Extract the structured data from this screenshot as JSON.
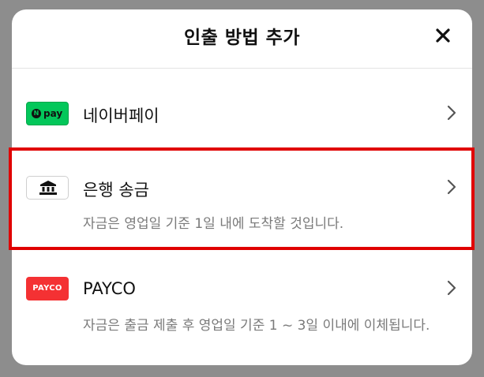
{
  "sheet": {
    "title": "인출 방법 추가",
    "close_icon": "close-icon"
  },
  "methods": [
    {
      "id": "npay",
      "name": "네이버페이",
      "logo_text": "pay",
      "logo_mark": "N",
      "logo_color": "#03c75a",
      "description": ""
    },
    {
      "id": "bank",
      "name": "은행 송금",
      "logo_icon": "bank-icon",
      "description": "자금은 영업일 기준 1일 내에 도착할 것입니다."
    },
    {
      "id": "payco",
      "name": "PAYCO",
      "logo_text": "PAYCO",
      "logo_color": "#f43133",
      "description": "자금은 출금 제출 후 영업일 기준 1 ~ 3일 이내에 이체됩니다."
    }
  ],
  "colors": {
    "highlight": "#e00000",
    "backdrop": "#8d8d8d"
  }
}
